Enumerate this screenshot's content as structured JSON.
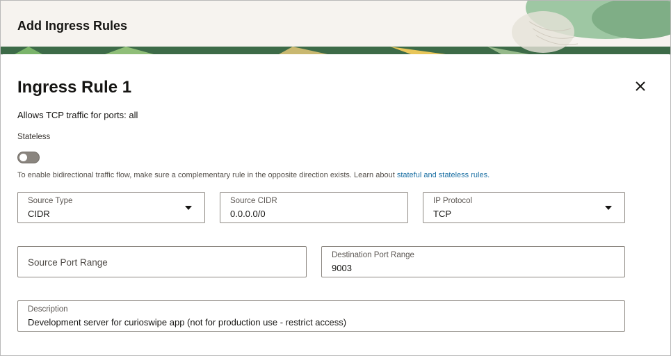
{
  "header": {
    "title": "Add Ingress Rules"
  },
  "rule": {
    "title": "Ingress Rule 1",
    "summary": "Allows TCP traffic for ports: all",
    "stateless_label": "Stateless",
    "stateless_on": false,
    "help_text": "To enable bidirectional traffic flow, make sure a complementary rule in the opposite direction exists. Learn about ",
    "help_link": "stateful and stateless rules."
  },
  "fields": {
    "source_type": {
      "label": "Source Type",
      "value": "CIDR"
    },
    "source_cidr": {
      "label": "Source CIDR",
      "value": "0.0.0.0/0"
    },
    "ip_protocol": {
      "label": "IP Protocol",
      "value": "TCP"
    },
    "source_port_range": {
      "placeholder": "Source Port Range",
      "value": ""
    },
    "destination_port_range": {
      "label": "Destination Port Range",
      "value": "9003"
    },
    "description": {
      "label": "Description",
      "value": "Development server for curioswipe app (not for production use - restrict access)"
    }
  },
  "icons": {
    "close": "close-icon",
    "dropdown": "chevron-down-icon"
  },
  "colors": {
    "header_bg": "#f6f3ef",
    "link": "#1a6fa3",
    "toggle_off": "#8a857f"
  }
}
